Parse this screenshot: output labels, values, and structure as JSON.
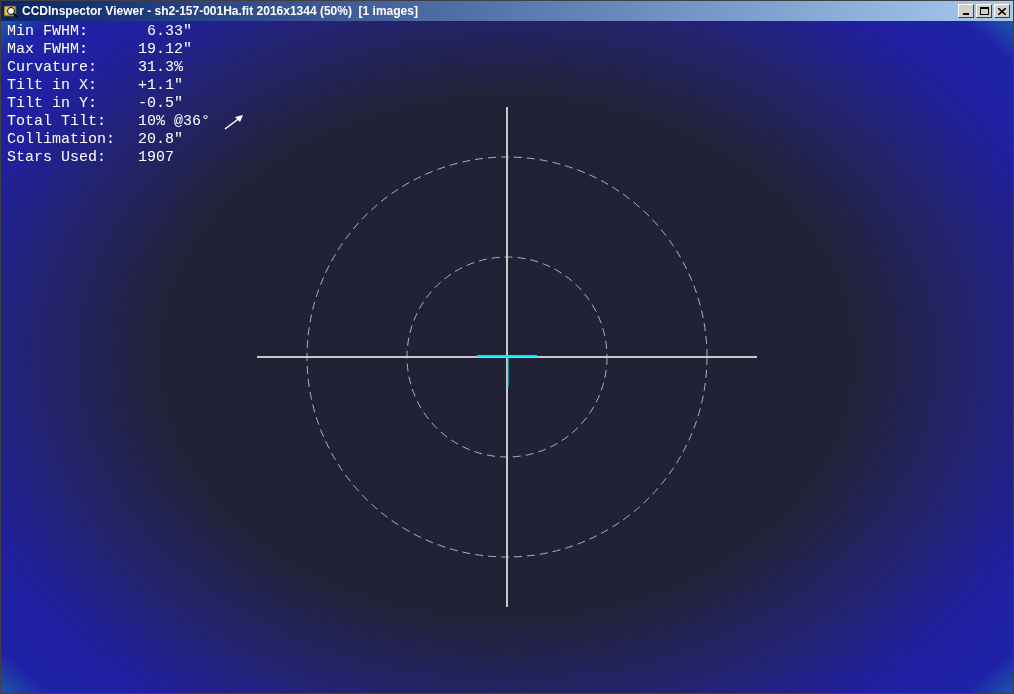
{
  "window": {
    "title": "CCDInspector Viewer - sh2-157-001Ha.fit 2016x1344 (50%)  [1 images]"
  },
  "stats": [
    {
      "label": "Min FWHM:",
      "value": " 6.33″"
    },
    {
      "label": "Max FWHM:",
      "value": "19.12″"
    },
    {
      "label": "Curvature:",
      "value": "31.3%"
    },
    {
      "label": "Tilt in X:",
      "value": "+1.1″"
    },
    {
      "label": "Tilt in Y:",
      "value": "-0.5″"
    },
    {
      "label": "Total Tilt:",
      "value": "10% @36°",
      "kind": "arrow"
    },
    {
      "label": "Collimation:",
      "value": "20.8″"
    },
    {
      "label": "Stars Used:",
      "value": "1907"
    }
  ]
}
